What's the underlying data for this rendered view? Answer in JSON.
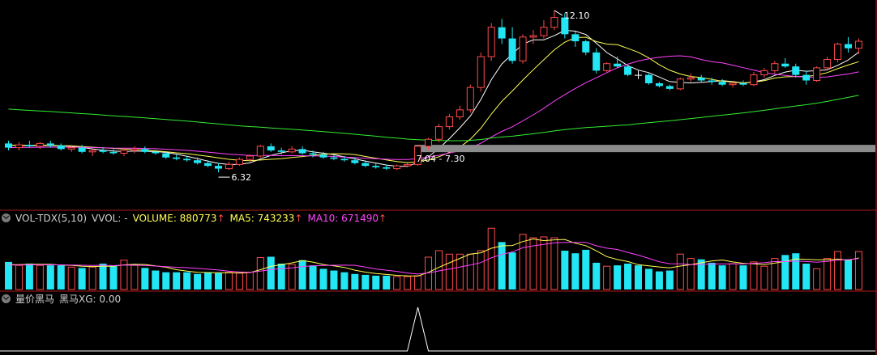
{
  "colors": {
    "up": "#ff4a4a",
    "down": "#22e6f4",
    "flat": "#ffffff",
    "ma5": "#ffffff",
    "ma10": "#ffff55",
    "ma20": "#ff44ff",
    "ma60": "#33ee33",
    "vol_ma5": "#ffff55",
    "vol_ma10": "#ff44ff",
    "separator": "#b01818",
    "signal": "#ffffff",
    "band": "#8c8c8c",
    "label": "#ffffff"
  },
  "price_annotations": {
    "high_label": "12.10",
    "low_label": "6.32",
    "range_label": "7.04 - 7.30"
  },
  "volume_panel": {
    "indicator": "VOL-TDX(5,10)",
    "vvol": "VVOL: -",
    "volume": "VOLUME: 880773",
    "ma5": "MA5: 743233",
    "ma10": "MA10: 671490",
    "arrow": "↑"
  },
  "signal_panel": {
    "title": "量价黑马",
    "series": "黑马XG: 0.00"
  },
  "chart_data": [
    {
      "type": "candlestick",
      "title": "",
      "ylim": [
        5.6,
        12.3
      ],
      "high_mark": 12.1,
      "low_mark": 6.32,
      "band": [
        7.04,
        7.3
      ],
      "ohlc": [
        [
          7.35,
          7.45,
          7.1,
          7.2
        ],
        [
          7.2,
          7.4,
          7.1,
          7.3
        ],
        [
          7.3,
          7.45,
          7.2,
          7.25
        ],
        [
          7.25,
          7.4,
          7.15,
          7.35
        ],
        [
          7.35,
          7.45,
          7.2,
          7.28
        ],
        [
          7.28,
          7.35,
          7.1,
          7.15
        ],
        [
          7.15,
          7.3,
          7.05,
          7.2
        ],
        [
          7.2,
          7.3,
          7.0,
          7.05
        ],
        [
          7.05,
          7.15,
          6.9,
          7.1
        ],
        [
          7.1,
          7.2,
          7.0,
          7.05
        ],
        [
          7.05,
          7.15,
          6.95,
          7.0
        ],
        [
          7.0,
          7.2,
          6.9,
          7.1
        ],
        [
          7.1,
          7.25,
          7.0,
          7.15
        ],
        [
          7.15,
          7.25,
          7.0,
          7.05
        ],
        [
          7.05,
          7.12,
          6.95,
          7.0
        ],
        [
          7.0,
          7.05,
          6.8,
          6.85
        ],
        [
          6.85,
          6.95,
          6.75,
          6.8
        ],
        [
          6.8,
          6.9,
          6.7,
          6.75
        ],
        [
          6.75,
          6.85,
          6.6,
          6.65
        ],
        [
          6.65,
          6.75,
          6.5,
          6.55
        ],
        [
          6.55,
          6.65,
          6.32,
          6.45
        ],
        [
          6.45,
          6.7,
          6.4,
          6.6
        ],
        [
          6.6,
          6.85,
          6.55,
          6.78
        ],
        [
          6.78,
          6.95,
          6.7,
          6.9
        ],
        [
          6.9,
          7.3,
          6.85,
          7.25
        ],
        [
          7.25,
          7.35,
          7.05,
          7.1
        ],
        [
          7.1,
          7.2,
          6.95,
          7.05
        ],
        [
          7.05,
          7.25,
          7.0,
          7.15
        ],
        [
          7.15,
          7.25,
          6.95,
          7.0
        ],
        [
          7.0,
          7.1,
          6.85,
          6.95
        ],
        [
          6.95,
          7.05,
          6.8,
          6.85
        ],
        [
          6.85,
          6.95,
          6.75,
          6.8
        ],
        [
          6.8,
          6.9,
          6.7,
          6.75
        ],
        [
          6.75,
          6.85,
          6.6,
          6.65
        ],
        [
          6.65,
          6.75,
          6.5,
          6.55
        ],
        [
          6.55,
          6.65,
          6.45,
          6.5
        ],
        [
          6.5,
          6.6,
          6.4,
          6.45
        ],
        [
          6.45,
          6.6,
          6.4,
          6.55
        ],
        [
          6.55,
          6.7,
          6.5,
          6.6
        ],
        [
          6.6,
          7.3,
          6.55,
          7.25
        ],
        [
          7.25,
          7.55,
          7.1,
          7.5
        ],
        [
          7.5,
          8.05,
          7.4,
          7.95
        ],
        [
          7.95,
          8.4,
          7.85,
          8.3
        ],
        [
          8.3,
          8.7,
          8.2,
          8.55
        ],
        [
          8.55,
          9.45,
          8.45,
          9.35
        ],
        [
          9.35,
          10.6,
          9.2,
          10.45
        ],
        [
          10.45,
          11.65,
          10.3,
          11.5
        ],
        [
          11.5,
          11.8,
          10.9,
          11.1
        ],
        [
          11.1,
          11.5,
          10.2,
          10.3
        ],
        [
          10.3,
          11.25,
          10.2,
          11.15
        ],
        [
          11.15,
          11.4,
          10.9,
          11.2
        ],
        [
          11.2,
          11.75,
          11.1,
          11.5
        ],
        [
          11.5,
          12.1,
          11.4,
          11.85
        ],
        [
          11.85,
          12.0,
          11.1,
          11.25
        ],
        [
          11.25,
          11.35,
          10.8,
          11.0
        ],
        [
          11.0,
          11.05,
          10.5,
          10.6
        ],
        [
          10.6,
          10.75,
          9.85,
          9.95
        ],
        [
          9.95,
          10.25,
          9.9,
          10.2
        ],
        [
          10.2,
          10.45,
          10.05,
          10.1
        ],
        [
          10.1,
          10.15,
          9.75,
          9.8
        ],
        [
          9.8,
          9.95,
          9.65,
          9.8
        ],
        [
          9.8,
          9.85,
          9.45,
          9.5
        ],
        [
          9.5,
          9.55,
          9.35,
          9.4
        ],
        [
          9.4,
          9.45,
          9.25,
          9.3
        ],
        [
          9.3,
          9.7,
          9.25,
          9.65
        ],
        [
          9.65,
          9.85,
          9.55,
          9.7
        ],
        [
          9.7,
          9.8,
          9.55,
          9.6
        ],
        [
          9.6,
          9.7,
          9.45,
          9.55
        ],
        [
          9.55,
          9.65,
          9.4,
          9.45
        ],
        [
          9.45,
          9.55,
          9.35,
          9.5
        ],
        [
          9.5,
          9.6,
          9.4,
          9.45
        ],
        [
          9.45,
          9.9,
          9.4,
          9.8
        ],
        [
          9.8,
          10.05,
          9.7,
          9.95
        ],
        [
          9.95,
          10.3,
          9.85,
          10.2
        ],
        [
          10.2,
          10.4,
          10.05,
          10.1
        ],
        [
          10.1,
          10.2,
          9.7,
          9.8
        ],
        [
          9.8,
          9.95,
          9.45,
          9.6
        ],
        [
          9.6,
          10.1,
          9.55,
          10.05
        ],
        [
          10.05,
          10.45,
          9.95,
          10.35
        ],
        [
          10.35,
          10.95,
          10.25,
          10.9
        ],
        [
          10.9,
          11.15,
          10.6,
          10.75
        ],
        [
          10.75,
          11.1,
          10.55,
          11.0
        ]
      ]
    },
    {
      "type": "bar",
      "title": "",
      "ylim": [
        0,
        1500000
      ],
      "volume": [
        640000,
        560000,
        600000,
        560000,
        560000,
        560000,
        520000,
        500000,
        520000,
        600000,
        560000,
        680000,
        560000,
        500000,
        440000,
        400000,
        400000,
        400000,
        360000,
        400000,
        380000,
        400000,
        380000,
        400000,
        740000,
        760000,
        600000,
        580000,
        680000,
        560000,
        480000,
        440000,
        400000,
        360000,
        340000,
        320000,
        320000,
        300000,
        300000,
        320000,
        750000,
        900000,
        820000,
        820000,
        820000,
        900000,
        1420000,
        1100000,
        860000,
        1280000,
        1200000,
        1220000,
        1200000,
        900000,
        840000,
        920000,
        620000,
        540000,
        560000,
        600000,
        560000,
        480000,
        420000,
        440000,
        820000,
        720000,
        700000,
        620000,
        560000,
        600000,
        560000,
        640000,
        540000,
        720000,
        800000,
        840000,
        600000,
        480000,
        720000,
        880773,
        700000,
        880000
      ],
      "series_names": [
        "MA5",
        "MA10"
      ]
    },
    {
      "type": "line",
      "title": "",
      "ylim": [
        0,
        1
      ],
      "series": [
        {
          "name": "黑马XG",
          "signal_index": 39,
          "value": 1
        }
      ],
      "last_value": 0.0
    }
  ]
}
